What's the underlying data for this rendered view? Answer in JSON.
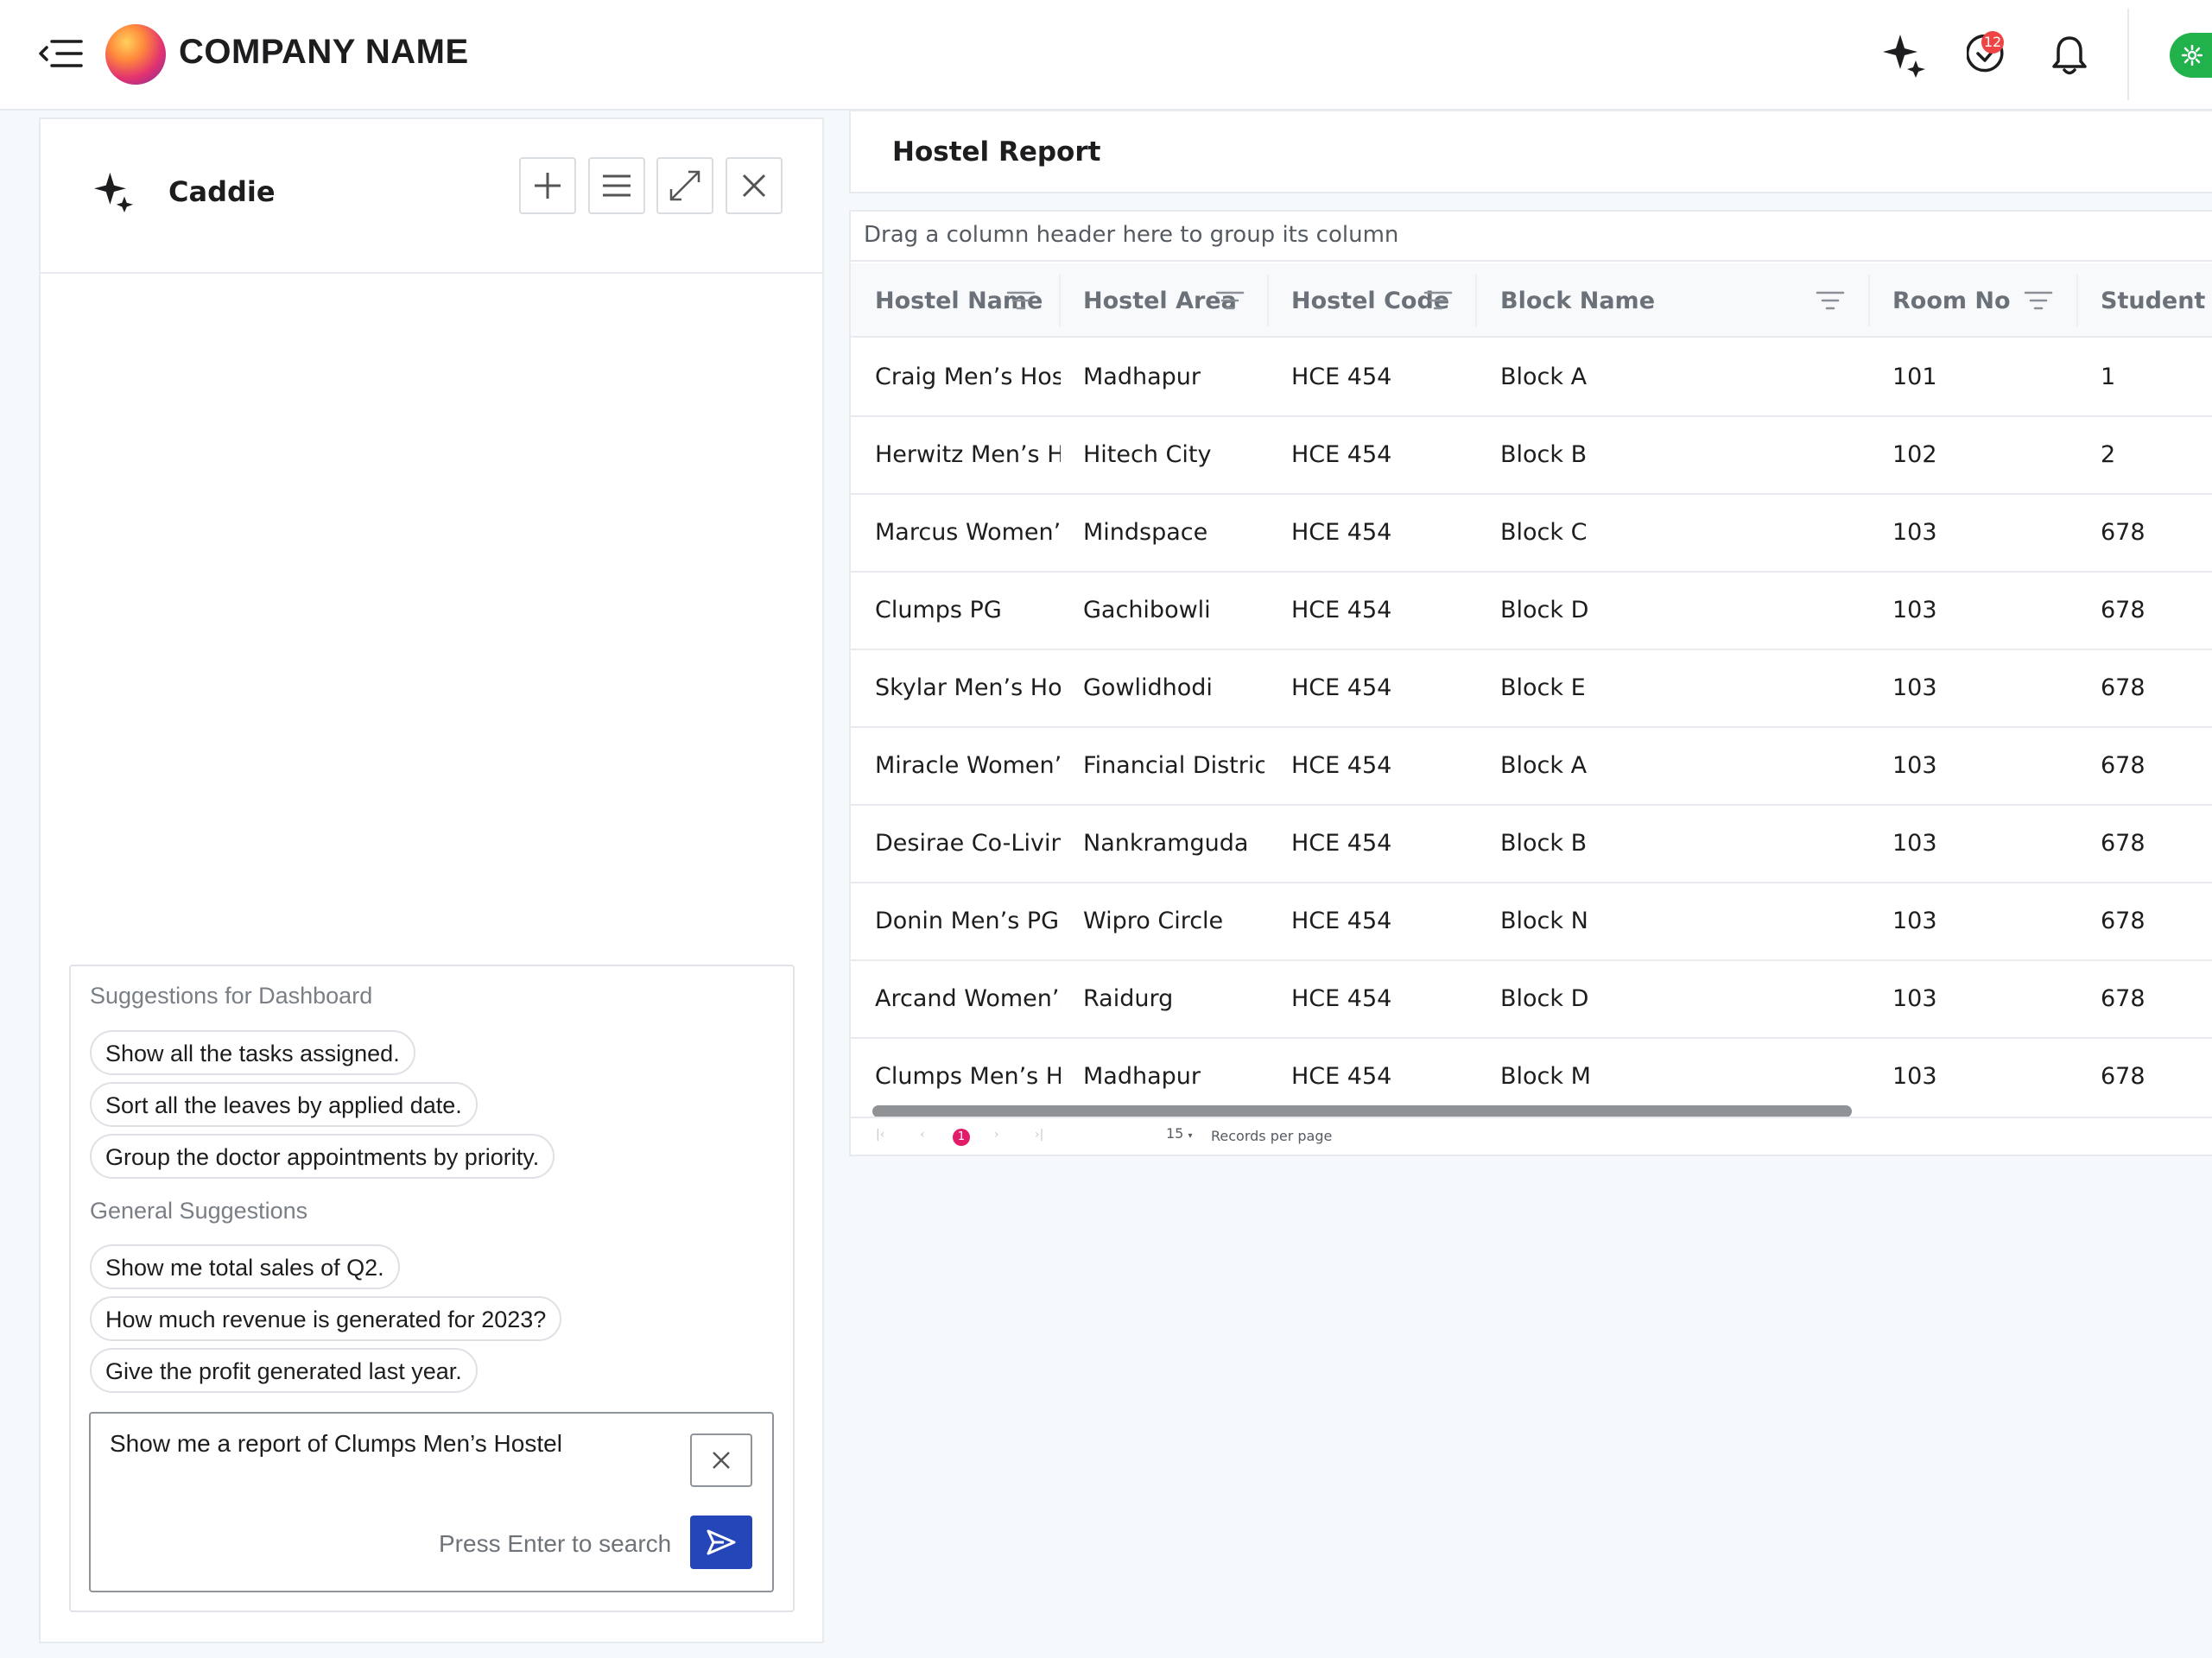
{
  "header": {
    "brand_name": "COMPANY NAME",
    "notification_count": "12",
    "icons": [
      "menu-collapse-icon",
      "sparkle-icon",
      "tasks-check-icon",
      "bell-icon",
      "settings-icon"
    ]
  },
  "caddie": {
    "title": "Caddie",
    "icons": [
      "sparkle-icon",
      "plus-icon",
      "menu-icon",
      "expand-icon",
      "close-icon"
    ],
    "dashboard_heading": "Suggestions for Dashboard",
    "dashboard_suggestions": [
      "Show all the tasks assigned.",
      "Sort all the leaves by applied date.",
      "Group the doctor appointments by priority."
    ],
    "general_heading": "General Suggestions",
    "general_suggestions": [
      "Show me total sales of Q2.",
      "How much revenue is generated for 2023?",
      "Give the profit generated last year."
    ],
    "query_value": "Show me a report of Clumps Men’s Hostel",
    "hint": "Press Enter to search"
  },
  "report": {
    "title": "Hostel Report",
    "group_hint": "Drag a column header here to group its column",
    "columns": [
      "Hostel Name",
      "Hostel Area",
      "Hostel Code",
      "Block Name",
      "Room No",
      "Student ID"
    ],
    "rows": [
      [
        "Craig Men’s Hostel",
        "Madhapur",
        "HCE 454",
        "Block A",
        "101",
        "1"
      ],
      [
        "Herwitz Men’s Hostel",
        "Hitech City",
        "HCE 454",
        "Block B",
        "102",
        "2"
      ],
      [
        "Marcus Women’s Hostel",
        "Mindspace",
        "HCE 454",
        "Block C",
        "103",
        "678"
      ],
      [
        "Clumps PG",
        "Gachibowli",
        "HCE 454",
        "Block D",
        "103",
        "678"
      ],
      [
        "Skylar Men’s Hostel",
        "Gowlidhodi",
        "HCE 454",
        "Block E",
        "103",
        "678"
      ],
      [
        "Miracle Women’s Hostel",
        "Financial District",
        "HCE 454",
        "Block A",
        "103",
        "678"
      ],
      [
        "Desirae Co-Living",
        "Nankramguda",
        "HCE 454",
        "Block B",
        "103",
        "678"
      ],
      [
        "Donin Men’s PG",
        "Wipro Circle",
        "HCE 454",
        "Block N",
        "103",
        "678"
      ],
      [
        "Arcand Women’s Hostel",
        "Raidurg",
        "HCE 454",
        "Block D",
        "103",
        "678"
      ],
      [
        "Clumps Men’s Hostel",
        "Madhapur",
        "HCE 454",
        "Block M",
        "103",
        "678"
      ]
    ],
    "pager": {
      "current_page": "1",
      "page_size": "15",
      "records_label": "Records per page"
    },
    "accent_color": "#e11d6a"
  },
  "colors": {
    "primary_button": "#2446b8",
    "status_green": "#22b24c",
    "badge_red": "#ef4444"
  }
}
